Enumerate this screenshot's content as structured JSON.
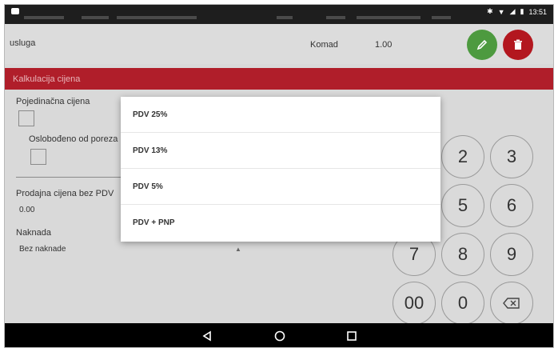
{
  "status": {
    "time": "13:51"
  },
  "item": {
    "name": "usluga",
    "unit": "Komad",
    "qty": "1.00"
  },
  "section": {
    "title": "Kalkulacija cijena"
  },
  "form": {
    "single_price_label": "Pojedinačna cijena",
    "tax_exempt_label": "Oslobođeno od poreza",
    "net_price_label": "Prodajna cijena bez PDV",
    "net_price_value": "0.00",
    "fee_label": "Naknada",
    "fee_value": "Bez naknade"
  },
  "keypad": {
    "keys": [
      "2",
      "3",
      "5",
      "6",
      "7",
      "8",
      "9",
      "00",
      "0"
    ]
  },
  "dialog": {
    "options": [
      "PDV 25%",
      "PDV 13%",
      "PDV 5%",
      "PDV + PNP"
    ]
  },
  "colors": {
    "header_red": "#b01e2a",
    "edit_green": "#4d9a3f",
    "delete_red": "#b3171f"
  }
}
